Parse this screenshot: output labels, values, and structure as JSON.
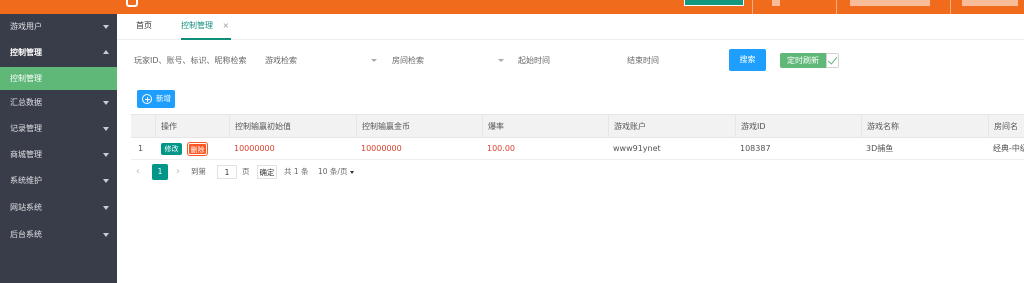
{
  "sidebar": {
    "items": [
      {
        "label": "游戏用户"
      },
      {
        "label": "控制管理"
      },
      {
        "label": "控制管理"
      },
      {
        "label": "汇总数据"
      },
      {
        "label": "记录管理"
      },
      {
        "label": "商城管理"
      },
      {
        "label": "系统维护"
      },
      {
        "label": "网站系统"
      },
      {
        "label": "后台系统"
      }
    ]
  },
  "tabs": [
    {
      "label": "首页"
    },
    {
      "label": "控制管理",
      "close": "×"
    }
  ],
  "search": {
    "player_placeholder": "玩家ID、账号、标识、昵称检索",
    "game_select": "游戏检索",
    "room_select": "房间检索",
    "start_time": "起始时间",
    "end_time": "结束时间",
    "search_label": "搜索",
    "refresh_label": "定时刷新"
  },
  "toolbar": {
    "add_label": "新增"
  },
  "table": {
    "headers": [
      "操作",
      "控制输赢初始值",
      "控制输赢金币",
      "爆率",
      "游戏账户",
      "游戏ID",
      "游戏名称",
      "房间名称"
    ],
    "rows": [
      {
        "index": "1",
        "edit_label": "修改",
        "delete_label": "删除",
        "initial_value": "10000000",
        "coins": "10000000",
        "rate": "100.00",
        "account": "www91ynet",
        "game_id": "108387",
        "game_name": "3D捕鱼",
        "room_name": "经典-中级"
      }
    ]
  },
  "pagination": {
    "current_page": "1",
    "goto_label": "到第",
    "page_input": "1",
    "page_unit": "页",
    "confirm_label": "确定",
    "total_label": "共 1 条",
    "page_size": "10 条/页"
  },
  "colors": {
    "topbar": "#f06b1b",
    "sidebar": "#393d49",
    "active_menu": "#5fb878",
    "primary_blue": "#1e9fff",
    "teal": "#009688",
    "danger": "#ff5722",
    "value_red": "#d9402c"
  }
}
